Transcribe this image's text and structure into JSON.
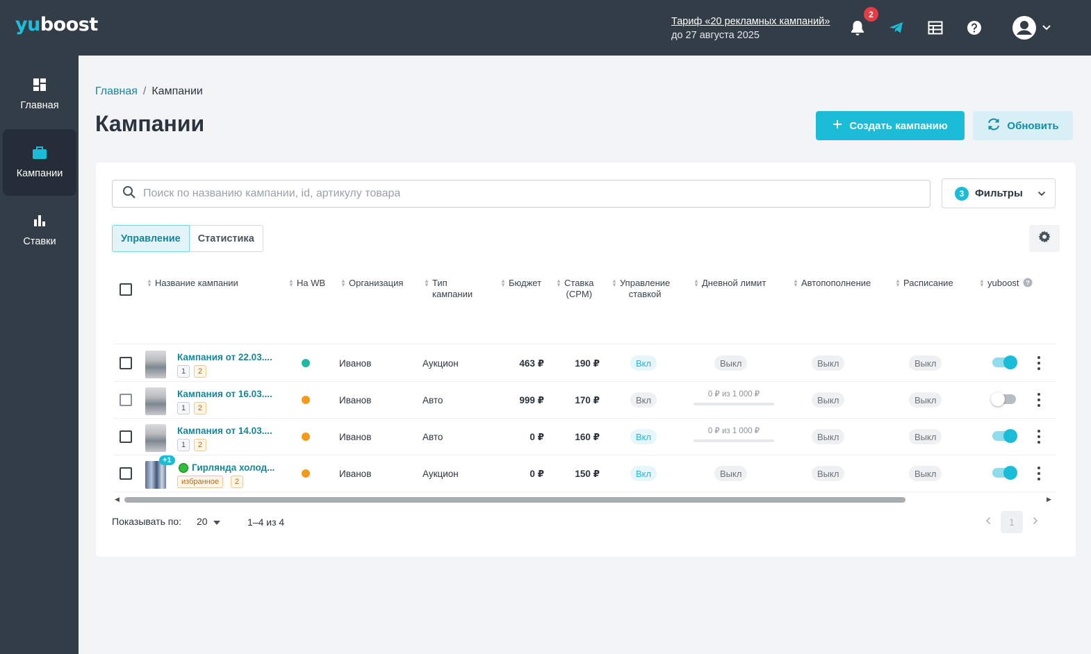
{
  "app": {
    "logo_y": "yu",
    "logo_rest": "boost"
  },
  "header": {
    "tariff_link": "Тариф «20 рекламных кампаний»",
    "tariff_until": "до 27 августа 2025",
    "notifications_count": "2"
  },
  "sidebar": {
    "items": [
      {
        "label": "Главная",
        "icon": "dashboard-icon"
      },
      {
        "label": "Кампании",
        "icon": "briefcase-icon",
        "active": true
      },
      {
        "label": "Ставки",
        "icon": "bar-chart-icon"
      }
    ]
  },
  "breadcrumb": {
    "home": "Главная",
    "separator": "/",
    "current": "Кампании"
  },
  "page": {
    "title": "Кампании",
    "create_label": "Создать кампанию",
    "refresh_label": "Обновить"
  },
  "search": {
    "placeholder": "Поиск по названию кампании, id, артикулу товара"
  },
  "filters": {
    "count": "3",
    "label": "Фильтры"
  },
  "tabs": [
    {
      "label": "Управление",
      "active": true
    },
    {
      "label": "Статистика"
    }
  ],
  "table": {
    "columns": {
      "name": "Название кампании",
      "onwb": "На WB",
      "org": "Организация",
      "type_1": "Тип",
      "type_2": "кампании",
      "budget": "Бюджет",
      "rate_1": "Ставка",
      "rate_2": "(CPM)",
      "bid_1": "Управление",
      "bid_2": "ставкой",
      "daily": "Дневной лимит",
      "auto": "Автопополнение",
      "schedule": "Расписание",
      "yuboost": "yuboost"
    },
    "rows": [
      {
        "name": "Кампания от 22.03....",
        "tags": [
          "1",
          "2"
        ],
        "status": "green",
        "org": "Иванов",
        "type": "Аукцион",
        "budget": "463 ₽",
        "rate": "190 ₽",
        "bid": "Вкл",
        "daily": "Выкл",
        "auto": "Выкл",
        "schedule": "Выкл",
        "yuboost": "on"
      },
      {
        "name": "Кампания от 16.03....",
        "tags": [
          "1",
          "2"
        ],
        "status": "orange",
        "org": "Иванов",
        "type": "Авто",
        "budget": "999 ₽",
        "rate": "170 ₽",
        "bid": "Вкл",
        "daily": "0 ₽ из 1 000 ₽",
        "auto": "Выкл",
        "schedule": "Выкл",
        "yuboost": "off"
      },
      {
        "name": "Кампания от 14.03....",
        "tags": [
          "1",
          "2"
        ],
        "status": "orange",
        "org": "Иванов",
        "type": "Авто",
        "budget": "0 ₽",
        "rate": "160 ₽",
        "bid": "Вкл",
        "daily": "0 ₽ из 1 000 ₽",
        "auto": "Выкл",
        "schedule": "Выкл",
        "yuboost": "on"
      },
      {
        "name": "Гирлянда холод...",
        "extra_products": "+1",
        "tags": [
          "избранное",
          "2"
        ],
        "status": "orange",
        "org": "Иванов",
        "type": "Аукцион",
        "budget": "0 ₽",
        "rate": "150 ₽",
        "bid": "Вкл",
        "daily": "Выкл",
        "auto": "Выкл",
        "schedule": "Выкл",
        "yuboost": "on"
      }
    ]
  },
  "pagination": {
    "per_page_label": "Показывать по:",
    "per_page": "20",
    "range": "1–4 из 4",
    "page": "1"
  },
  "colors": {
    "accent": "#1bbcd8",
    "topbar": "#333d48",
    "status_green": "#1fb8a4",
    "status_orange": "#f39a1e"
  }
}
